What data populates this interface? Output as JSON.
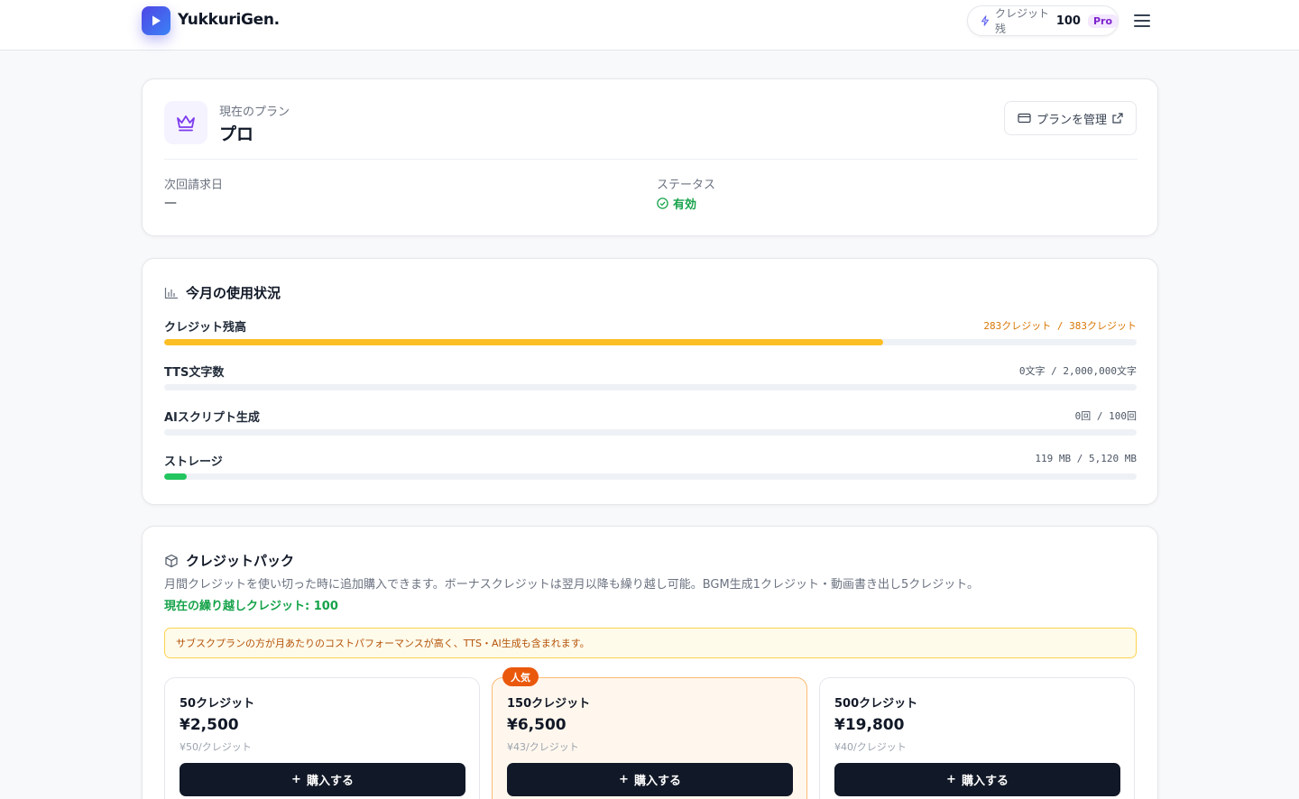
{
  "header": {
    "app_name": "YukkuriGen.",
    "credits_label": "クレジット残",
    "credits_value": "100",
    "plan_badge": "Pro",
    "icons": {
      "logo": "play-icon",
      "credits": "bolt-icon",
      "menu": "hamburger-menu-icon"
    }
  },
  "current_plan": {
    "label": "現在のプラン",
    "name": "プロ",
    "manage_button": "プランを管理",
    "next_billing_label": "次回請求日",
    "next_billing_value": "—",
    "status_label": "ステータス",
    "status_value": "有効",
    "colors": {
      "status": "#16a34a",
      "crown": "#7c3aed"
    }
  },
  "usage": {
    "title": "今月の使用状況",
    "rows": [
      {
        "label": "クレジット残高",
        "value": "283クレジット / 383クレジット",
        "fraction": 0.739,
        "color": "#fbbf24",
        "value_color": "#d97706"
      },
      {
        "label": "TTS文字数",
        "value": "0文字 / 2,000,000文字",
        "fraction": 0,
        "color": "#fbbf24",
        "value_color": "#4b5563"
      },
      {
        "label": "AIスクリプト生成",
        "value": "0回 / 100回",
        "fraction": 0,
        "color": "#fbbf24",
        "value_color": "#4b5563"
      },
      {
        "label": "ストレージ",
        "value": "119 MB / 5,120 MB",
        "fraction": 0.0232,
        "color": "#22c55e",
        "value_color": "#4b5563"
      }
    ]
  },
  "credit_packs": {
    "title": "クレジットパック",
    "description": "月間クレジットを使い切った時に追加購入できます。ボーナスクレジットは翌月以降も繰り越し可能。BGM生成1クレジット・動画書き出し5クレジット。",
    "carryover": "現在の繰り越しクレジット: 100",
    "notice": "サブスクプランの方が月あたりのコストパフォーマンスが高く、TTS・AI生成も含まれます。",
    "popular_badge": "人気",
    "buy_label": "購入する",
    "packs": [
      {
        "name": "50クレジット",
        "price": "¥2,500",
        "unit": "¥50/クレジット"
      },
      {
        "name": "150クレジット",
        "price": "¥6,500",
        "unit": "¥43/クレジット"
      },
      {
        "name": "500クレジット",
        "price": "¥19,800",
        "unit": "¥40/クレジット"
      }
    ]
  }
}
